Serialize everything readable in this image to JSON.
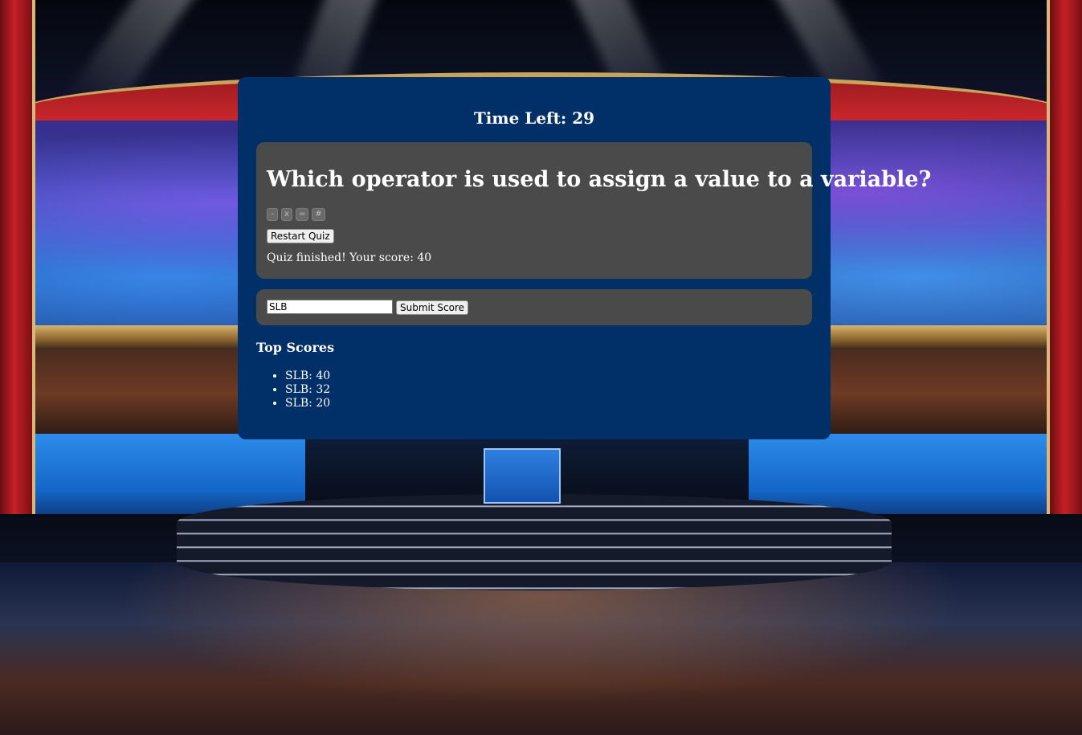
{
  "timer": {
    "label": "Time Left:",
    "value": "29"
  },
  "question": {
    "text": "Which operator is used to assign a value to a variable?",
    "answers": [
      "-",
      "x",
      "=",
      "#"
    ]
  },
  "controls": {
    "restart_label": "Restart Quiz",
    "submit_label": "Submit Score"
  },
  "result": {
    "text": "Quiz finished! Your score: 40"
  },
  "name_field": {
    "value": "SLB"
  },
  "leaderboard": {
    "title": "Top Scores",
    "entries": [
      "SLB: 40",
      "SLB: 32",
      "SLB: 20"
    ]
  },
  "colors": {
    "card_bg": "#013068",
    "panel_bg": "#4a4a4a",
    "text": "#ffffff"
  }
}
